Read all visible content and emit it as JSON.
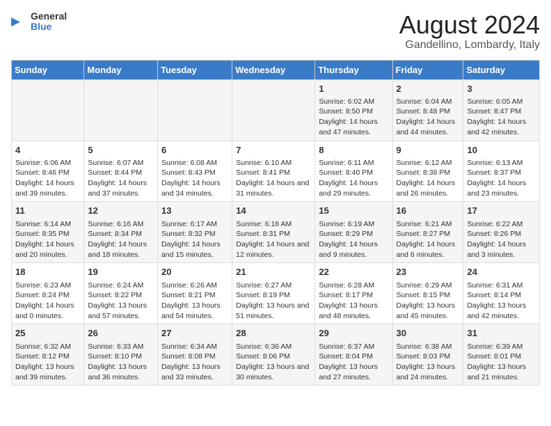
{
  "logo": {
    "line1": "General",
    "line2": "Blue"
  },
  "title": "August 2024",
  "subtitle": "Gandellino, Lombardy, Italy",
  "headers": [
    "Sunday",
    "Monday",
    "Tuesday",
    "Wednesday",
    "Thursday",
    "Friday",
    "Saturday"
  ],
  "weeks": [
    [
      {
        "day": "",
        "info": ""
      },
      {
        "day": "",
        "info": ""
      },
      {
        "day": "",
        "info": ""
      },
      {
        "day": "",
        "info": ""
      },
      {
        "day": "1",
        "info": "Sunrise: 6:02 AM\nSunset: 8:50 PM\nDaylight: 14 hours and 47 minutes."
      },
      {
        "day": "2",
        "info": "Sunrise: 6:04 AM\nSunset: 8:48 PM\nDaylight: 14 hours and 44 minutes."
      },
      {
        "day": "3",
        "info": "Sunrise: 6:05 AM\nSunset: 8:47 PM\nDaylight: 14 hours and 42 minutes."
      }
    ],
    [
      {
        "day": "4",
        "info": "Sunrise: 6:06 AM\nSunset: 8:46 PM\nDaylight: 14 hours and 39 minutes."
      },
      {
        "day": "5",
        "info": "Sunrise: 6:07 AM\nSunset: 8:44 PM\nDaylight: 14 hours and 37 minutes."
      },
      {
        "day": "6",
        "info": "Sunrise: 6:08 AM\nSunset: 8:43 PM\nDaylight: 14 hours and 34 minutes."
      },
      {
        "day": "7",
        "info": "Sunrise: 6:10 AM\nSunset: 8:41 PM\nDaylight: 14 hours and 31 minutes."
      },
      {
        "day": "8",
        "info": "Sunrise: 6:11 AM\nSunset: 8:40 PM\nDaylight: 14 hours and 29 minutes."
      },
      {
        "day": "9",
        "info": "Sunrise: 6:12 AM\nSunset: 8:38 PM\nDaylight: 14 hours and 26 minutes."
      },
      {
        "day": "10",
        "info": "Sunrise: 6:13 AM\nSunset: 8:37 PM\nDaylight: 14 hours and 23 minutes."
      }
    ],
    [
      {
        "day": "11",
        "info": "Sunrise: 6:14 AM\nSunset: 8:35 PM\nDaylight: 14 hours and 20 minutes."
      },
      {
        "day": "12",
        "info": "Sunrise: 6:16 AM\nSunset: 8:34 PM\nDaylight: 14 hours and 18 minutes."
      },
      {
        "day": "13",
        "info": "Sunrise: 6:17 AM\nSunset: 8:32 PM\nDaylight: 14 hours and 15 minutes."
      },
      {
        "day": "14",
        "info": "Sunrise: 6:18 AM\nSunset: 8:31 PM\nDaylight: 14 hours and 12 minutes."
      },
      {
        "day": "15",
        "info": "Sunrise: 6:19 AM\nSunset: 8:29 PM\nDaylight: 14 hours and 9 minutes."
      },
      {
        "day": "16",
        "info": "Sunrise: 6:21 AM\nSunset: 8:27 PM\nDaylight: 14 hours and 6 minutes."
      },
      {
        "day": "17",
        "info": "Sunrise: 6:22 AM\nSunset: 8:26 PM\nDaylight: 14 hours and 3 minutes."
      }
    ],
    [
      {
        "day": "18",
        "info": "Sunrise: 6:23 AM\nSunset: 8:24 PM\nDaylight: 14 hours and 0 minutes."
      },
      {
        "day": "19",
        "info": "Sunrise: 6:24 AM\nSunset: 8:22 PM\nDaylight: 13 hours and 57 minutes."
      },
      {
        "day": "20",
        "info": "Sunrise: 6:26 AM\nSunset: 8:21 PM\nDaylight: 13 hours and 54 minutes."
      },
      {
        "day": "21",
        "info": "Sunrise: 6:27 AM\nSunset: 8:19 PM\nDaylight: 13 hours and 51 minutes."
      },
      {
        "day": "22",
        "info": "Sunrise: 6:28 AM\nSunset: 8:17 PM\nDaylight: 13 hours and 48 minutes."
      },
      {
        "day": "23",
        "info": "Sunrise: 6:29 AM\nSunset: 8:15 PM\nDaylight: 13 hours and 45 minutes."
      },
      {
        "day": "24",
        "info": "Sunrise: 6:31 AM\nSunset: 8:14 PM\nDaylight: 13 hours and 42 minutes."
      }
    ],
    [
      {
        "day": "25",
        "info": "Sunrise: 6:32 AM\nSunset: 8:12 PM\nDaylight: 13 hours and 39 minutes."
      },
      {
        "day": "26",
        "info": "Sunrise: 6:33 AM\nSunset: 8:10 PM\nDaylight: 13 hours and 36 minutes."
      },
      {
        "day": "27",
        "info": "Sunrise: 6:34 AM\nSunset: 8:08 PM\nDaylight: 13 hours and 33 minutes."
      },
      {
        "day": "28",
        "info": "Sunrise: 6:36 AM\nSunset: 8:06 PM\nDaylight: 13 hours and 30 minutes."
      },
      {
        "day": "29",
        "info": "Sunrise: 6:37 AM\nSunset: 8:04 PM\nDaylight: 13 hours and 27 minutes."
      },
      {
        "day": "30",
        "info": "Sunrise: 6:38 AM\nSunset: 8:03 PM\nDaylight: 13 hours and 24 minutes."
      },
      {
        "day": "31",
        "info": "Sunrise: 6:39 AM\nSunset: 8:01 PM\nDaylight: 13 hours and 21 minutes."
      }
    ]
  ]
}
